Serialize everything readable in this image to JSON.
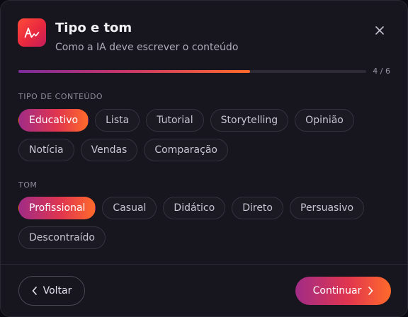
{
  "header": {
    "title": "Tipo e tom",
    "subtitle": "Como a IA deve escrever o conteúdo",
    "icon": "ai-writing-icon",
    "close_icon": "close-icon"
  },
  "progress": {
    "step_label": "4 / 6",
    "fraction": 0.667
  },
  "content_type": {
    "label": "TIPO DE CONTEÚDO",
    "options": [
      "Educativo",
      "Lista",
      "Tutorial",
      "Storytelling",
      "Opinião",
      "Notícia",
      "Vendas",
      "Comparação"
    ],
    "selected": "Educativo"
  },
  "tone": {
    "label": "TOM",
    "options": [
      "Profissional",
      "Casual",
      "Didático",
      "Direto",
      "Persuasivo",
      "Descontraído"
    ],
    "selected": "Profissional"
  },
  "footer": {
    "back_label": "Voltar",
    "continue_label": "Continuar",
    "back_icon": "chevron-left-icon",
    "continue_icon": "chevron-right-icon"
  },
  "colors": {
    "accent_start": "#a12c86",
    "accent_mid": "#e0354f",
    "accent_end": "#ff6a2b",
    "background": "#17151d"
  }
}
